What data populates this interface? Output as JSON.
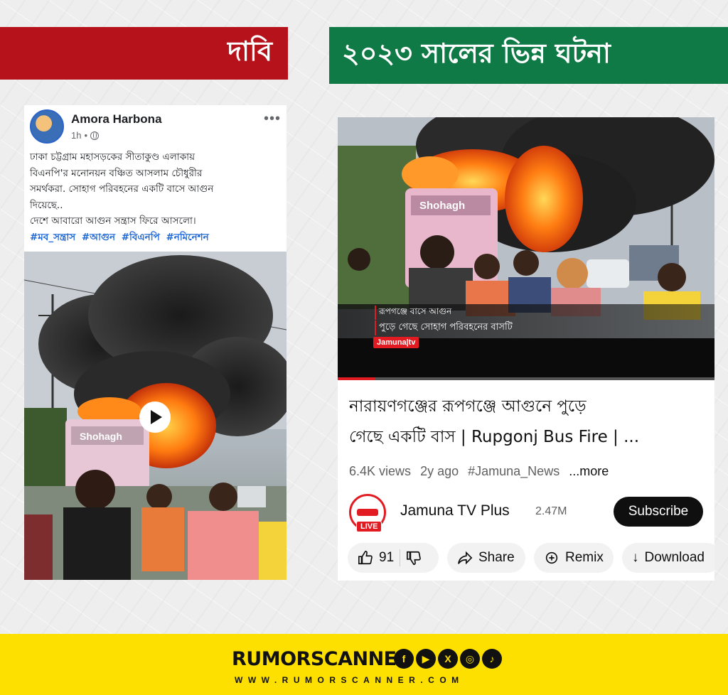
{
  "claim_banner": {
    "label": "দাবি"
  },
  "fact_banner": {
    "label": "২০২৩ সালের ভিন্ন ঘটনা"
  },
  "facebook_post": {
    "author": "Amora Harbona",
    "time": "1h",
    "separator": "•",
    "more": "•••",
    "text_lines": [
      "ঢাকা চট্টগ্রাম মহাসড়কের সীতাকুণ্ড এলাকায়",
      "বিএনপি'র মনোনয়ন বঞ্চিত আসলাম চৌধুরীর",
      "সমর্থকরা. সোহাগ পরিবহনের একটি বাসে আগুন",
      "দিয়েছে..",
      "দেশে আবারো আগুন সন্ত্রাস ফিরে আসলো।"
    ],
    "hashtags": [
      "#মব_সন্ত্রাস",
      "#আগুন",
      "#বিএনপি",
      "#নমিনেশন"
    ],
    "video_bus_label": "Shohagh"
  },
  "youtube": {
    "overlay_line1": "রূপগঞ্জে বাসে আগুন",
    "overlay_line2": "পুড়ে গেছে সোহাগ পরিবহনের বাসটি",
    "overlay_logo": "Jamuna|tv",
    "video_bus_label": "Shohagh",
    "progress_fraction": 0.1,
    "title_line1": "নারায়ণগঞ্জের রূপগঞ্জে আগুনে পুড়ে",
    "title_line2": "গেছে একটি বাস | Rupgonj Bus Fire | ...",
    "views": "6.4K views",
    "age": "2y ago",
    "hashtag": "#Jamuna_News",
    "more": "...more",
    "channel_name": "Jamuna TV Plus",
    "subscribers": "2.47M",
    "live_badge": "LIVE",
    "subscribe_label": "Subscribe",
    "likes": "91",
    "share_label": "Share",
    "remix_label": "Remix",
    "download_label": "Download"
  },
  "footer": {
    "brand": "RUMORSCANNER",
    "url": "WWW.RUMORSCANNER.COM",
    "social_icons": [
      "facebook-icon",
      "youtube-icon",
      "x-icon",
      "instagram-icon",
      "tiktok-icon"
    ]
  },
  "colors": {
    "claim_red": "#b5121b",
    "fact_green": "#0f7a46",
    "footer_yellow": "#fde000",
    "youtube_red": "#e21b22",
    "link_blue": "#1b66d6"
  }
}
